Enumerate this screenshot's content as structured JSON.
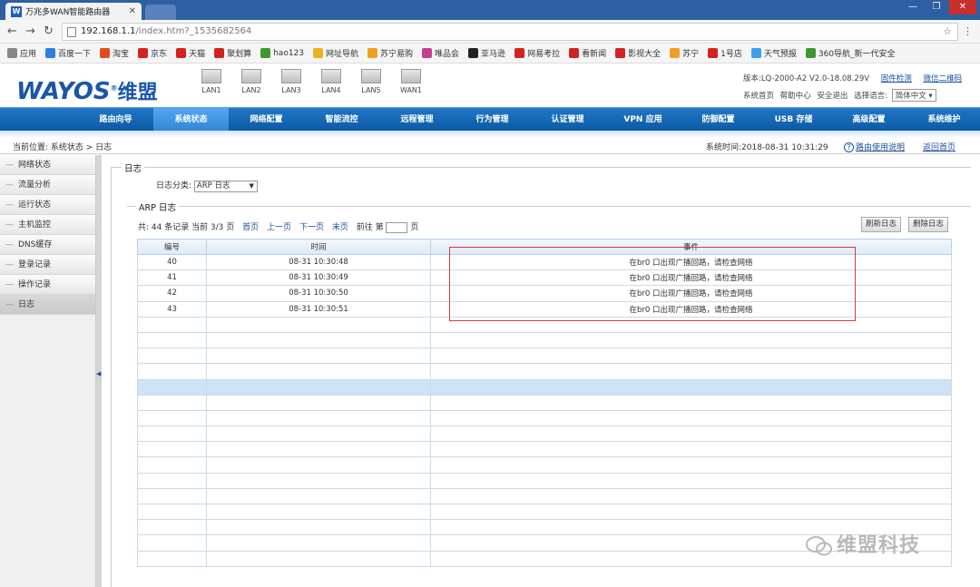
{
  "browser": {
    "tab_title": "万兆多WAN智能路由器",
    "favicon_letter": "W",
    "url_host": "192.168.1.1",
    "url_path": "/index.htm?_1535682564"
  },
  "bookmarks": [
    {
      "label": "应用",
      "color": "#888888"
    },
    {
      "label": "百度一下",
      "color": "#2d7fe0"
    },
    {
      "label": "淘宝",
      "color": "#e04b1f"
    },
    {
      "label": "京东",
      "color": "#d4221f"
    },
    {
      "label": "天猫",
      "color": "#d4221f"
    },
    {
      "label": "聚划算",
      "color": "#d4221f"
    },
    {
      "label": "hao123",
      "color": "#3a9a2d"
    },
    {
      "label": "网址导航",
      "color": "#e8b31d"
    },
    {
      "label": "苏宁易购",
      "color": "#f0a020"
    },
    {
      "label": "唯品会",
      "color": "#c83c8c"
    },
    {
      "label": "亚马逊",
      "color": "#222222"
    },
    {
      "label": "网易考拉",
      "color": "#d4221f"
    },
    {
      "label": "看新闻",
      "color": "#d4221f"
    },
    {
      "label": "影视大全",
      "color": "#d4221f"
    },
    {
      "label": "苏宁",
      "color": "#f0a020"
    },
    {
      "label": "1号店",
      "color": "#d4221f"
    },
    {
      "label": "天气预报",
      "color": "#3aa0e8"
    },
    {
      "label": "360导航_新一代安全",
      "color": "#3a9a2d"
    }
  ],
  "router": {
    "logo_text": "WAYOS",
    "logo_cn": "维盟",
    "ports": [
      "LAN1",
      "LAN2",
      "LAN3",
      "LAN4",
      "LAN5",
      "WAN1"
    ],
    "version": "版本:LQ-2000-A2 V2.0-18.08.29V",
    "firmware_check": "固件检测",
    "wechat_qr": "微信二维码",
    "sys_home": "系统首页",
    "help_center": "帮助中心",
    "safe_exit": "安全退出",
    "lang_label": "选择语言:",
    "lang_value": "简体中文"
  },
  "menu": [
    "路由向导",
    "系统状态",
    "网络配置",
    "智能流控",
    "远程管理",
    "行为管理",
    "认证管理",
    "VPN 应用",
    "防御配置",
    "USB 存储",
    "高级配置",
    "系统维护"
  ],
  "location": {
    "breadcrumb": "当前位置: 系统状态 > 日志",
    "system_time": "系统时间:2018-08-31 10:31:29",
    "help": "路由使用说明",
    "home": "返回首页"
  },
  "sidebar": [
    "网络状态",
    "流量分析",
    "运行状态",
    "主机监控",
    "DNS缓存",
    "登录记录",
    "操作记录",
    "日志"
  ],
  "log": {
    "section_title": "日志",
    "category_label": "日志分类:",
    "category_value": "ARP 日志",
    "arp_title": "ARP 日志",
    "pager": {
      "summary": "共: 44 条记录 当前 3/3 页",
      "first": "首页",
      "prev": "上一页",
      "next": "下一页",
      "last": "末页",
      "goto": "前往 第",
      "page": "页"
    },
    "refresh": "刷新日志",
    "delete": "删除日志",
    "columns": [
      "编号",
      "时间",
      "事件"
    ],
    "rows": [
      {
        "id": "40",
        "time": "08-31 10:30:48",
        "event": "在br0 口出现广播回路，请检查网络"
      },
      {
        "id": "41",
        "time": "08-31 10:30:49",
        "event": "在br0 口出现广播回路，请检查网络"
      },
      {
        "id": "42",
        "time": "08-31 10:30:50",
        "event": "在br0 口出现广播回路，请检查网络"
      },
      {
        "id": "43",
        "time": "08-31 10:30:51",
        "event": "在br0 口出现广播回路，请检查网络"
      }
    ]
  },
  "watermark": "维盟科技"
}
